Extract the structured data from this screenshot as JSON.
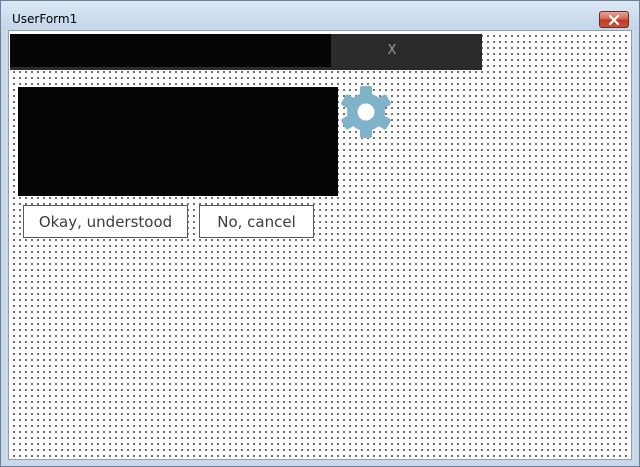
{
  "window": {
    "title": "UserForm1",
    "close_icon": "close-x-icon"
  },
  "form": {
    "header_close_label": "X",
    "settings_icon": "gear-icon",
    "settings_icon_color": "#7fb3c9",
    "buttons": {
      "confirm_label": "Okay, understood",
      "cancel_label": "No, cancel"
    }
  }
}
